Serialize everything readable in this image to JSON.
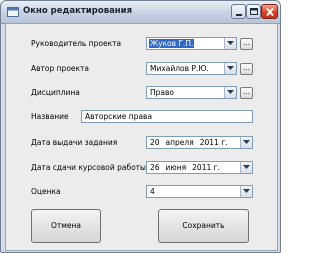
{
  "window": {
    "title": "Окно редактирования"
  },
  "form": {
    "fields": [
      {
        "label": "Руководитель проекта",
        "value": "Жуков Г.П.",
        "has_browse": true
      },
      {
        "label": "Автор проекта",
        "value": "Михайлов Р.Ю.",
        "has_browse": true
      },
      {
        "label": "Дисциплина",
        "value": "Право",
        "has_browse": true
      },
      {
        "label": "Название",
        "value": "Авторские права"
      },
      {
        "label": "Дата выдачи задания",
        "day": "20",
        "month": "апреля",
        "year": "2011 г."
      },
      {
        "label": "Дата сдачи курсовой работы",
        "day": "26",
        "month": "июня",
        "year": "2011 г."
      },
      {
        "label": "Оценка",
        "value": "4"
      }
    ],
    "browse_label": "...",
    "buttons": {
      "cancel": "Отмена",
      "save": "Сохранить"
    }
  },
  "colors": {
    "selection": "#3168c5",
    "close_button": "#d8442a"
  },
  "icons": [
    "window-app-icon",
    "minimize-icon",
    "maximize-icon",
    "close-icon",
    "dropdown-arrow-icon"
  ]
}
